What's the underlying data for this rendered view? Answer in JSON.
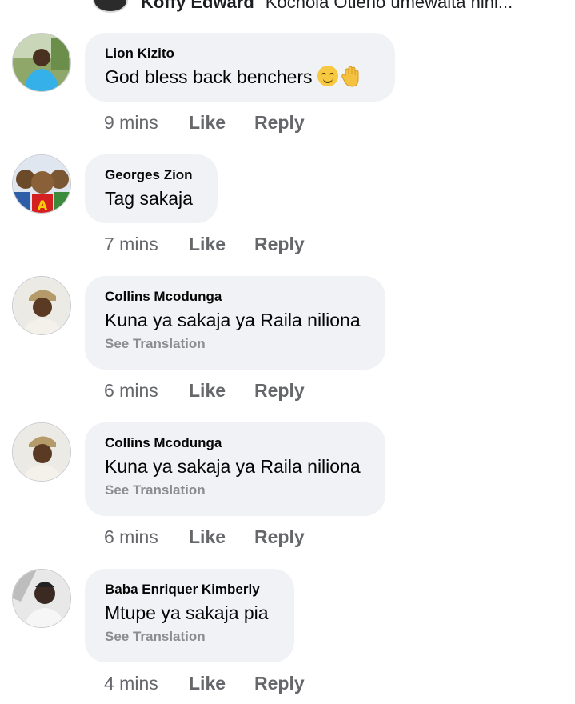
{
  "top_reply": {
    "author": "Koffy Edward",
    "text": "Kochola Otieno umewaita nini..."
  },
  "labels": {
    "like": "Like",
    "reply": "Reply"
  },
  "comments": [
    {
      "author": "Lion Kizito",
      "text": "God bless back benchers",
      "time": "9 mins",
      "emoji": [
        "smile-emoji",
        "raised-hand-emoji"
      ]
    },
    {
      "author": "Georges Zion",
      "text": "Tag sakaja",
      "time": "7 mins"
    },
    {
      "author": "Collins Mcodunga",
      "text": "Kuna ya sakaja ya Raila niliona",
      "translation": "See Translation",
      "time": "6 mins"
    },
    {
      "author": "Collins Mcodunga",
      "text": "Kuna ya sakaja ya Raila niliona",
      "translation": "See Translation",
      "time": "6 mins"
    },
    {
      "author": "Baba Enriquer Kimberly",
      "text": "Mtupe ya sakaja pia",
      "translation": "See Translation",
      "time": "4 mins"
    }
  ],
  "colors": {
    "bubble": "#f0f2f5",
    "meta": "#65676b",
    "translate": "#8a8d91"
  }
}
